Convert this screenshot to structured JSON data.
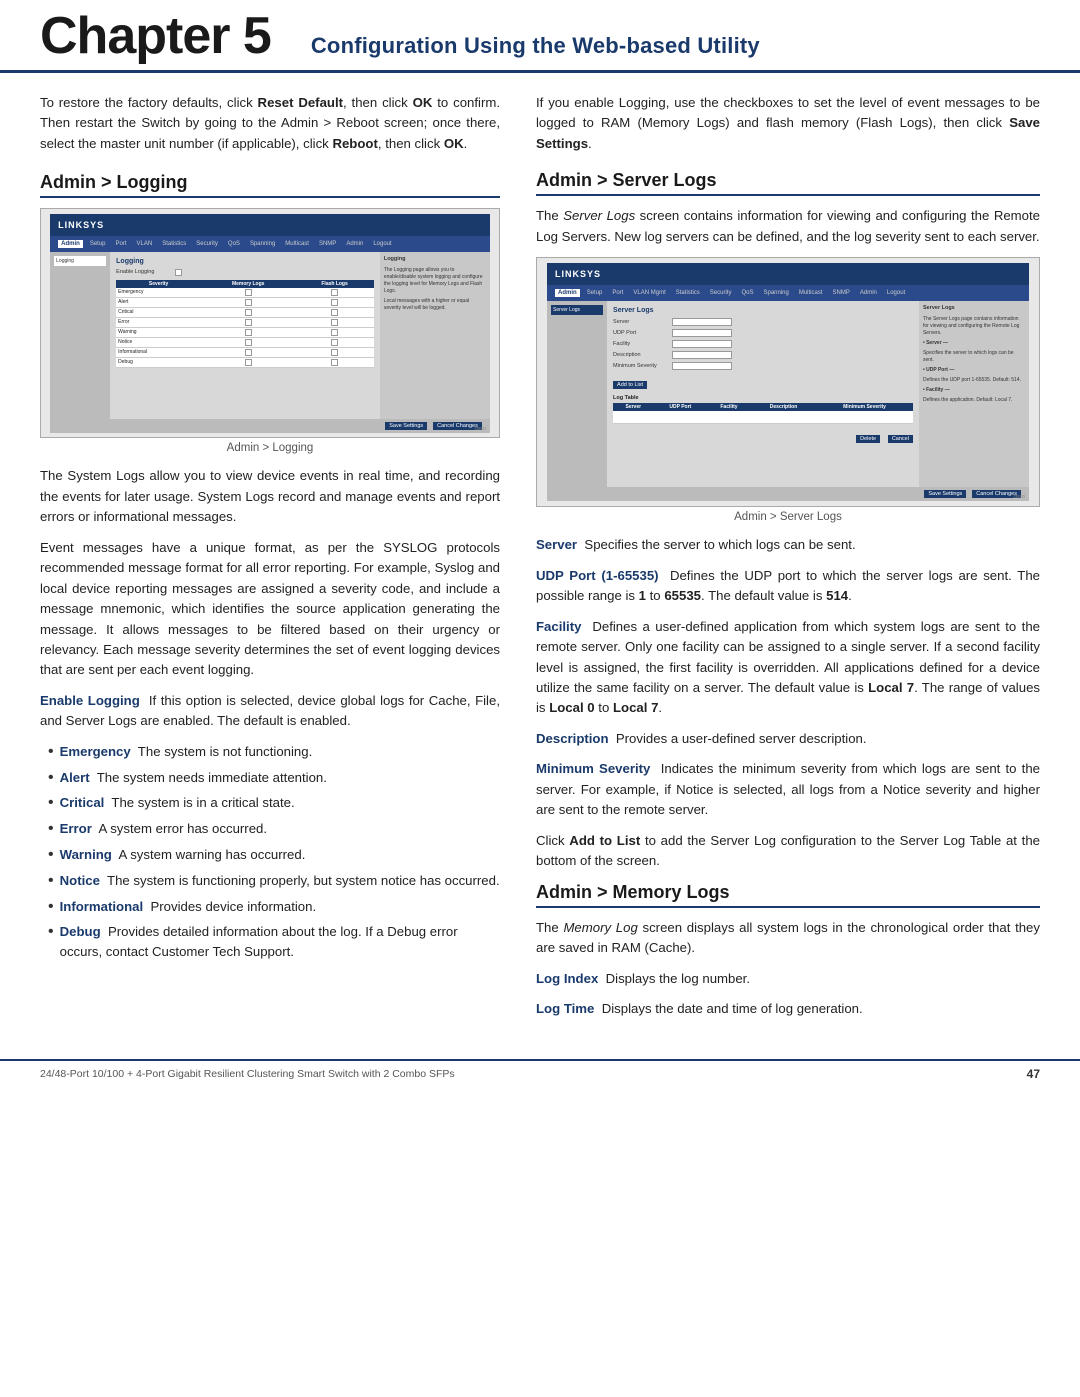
{
  "header": {
    "chapter_label": "Chapter 5",
    "subtitle": "Configuration Using the Web-based Utility"
  },
  "left_col": {
    "intro_paragraph": "To restore the factory defaults, click Reset Default, then click OK to confirm. Then restart the Switch by going to the Admin > Reboot screen; once there, select the master unit number (if applicable), click Reboot, then click OK.",
    "section1_heading": "Admin > Logging",
    "screenshot1_caption": "Admin > Logging",
    "body_paragraph1": "The System Logs allow you to view device events in real time, and recording the events for later usage. System Logs record and manage events and report errors or informational messages.",
    "body_paragraph2": "Event messages have a unique format, as per the SYSLOG protocols recommended message format for all error reporting. For example, Syslog and local device reporting messages are assigned a severity code, and include a message mnemonic, which identifies the source application generating the message. It allows messages to be filtered based on their urgency or relevancy. Each message severity determines the set of event logging devices that are sent per each event logging.",
    "enable_logging_term": "Enable Logging",
    "enable_logging_desc": "If this option is selected, device global logs for Cache, File, and Server Logs are enabled. The default is enabled.",
    "bullets": [
      {
        "term": "Emergency",
        "desc": "The system is not functioning."
      },
      {
        "term": "Alert",
        "desc": "The system needs immediate attention."
      },
      {
        "term": "Critical",
        "desc": "The system is in a critical state."
      },
      {
        "term": "Error",
        "desc": "A system error has occurred."
      },
      {
        "term": "Warning",
        "desc": "A system warning has occurred."
      },
      {
        "term": "Notice",
        "desc": "The system is functioning properly, but system notice has occurred."
      },
      {
        "term": "Informational",
        "desc": "Provides device information."
      },
      {
        "term": "Debug",
        "desc": "Provides detailed information about the log. If a Debug error occurs, contact Customer Tech Support."
      }
    ]
  },
  "right_col": {
    "intro_paragraph": "If you enable Logging, use the checkboxes to set the level of event messages to be logged to RAM (Memory Logs) and flash memory (Flash Logs), then click Save Settings.",
    "section2_heading": "Admin > Server Logs",
    "server_logs_intro": "The Server Logs screen contains information for viewing and configuring the Remote Log Servers. New log servers can be defined, and the log severity sent to each server.",
    "screenshot2_caption": "Admin > Server Logs",
    "definitions": [
      {
        "term": "Server",
        "desc": "Specifies the server to which logs can be sent."
      },
      {
        "term": "UDP Port (1-65535)",
        "desc": "Defines the UDP port to which the server logs are sent. The possible range is 1 to 65535. The default value is 514."
      },
      {
        "term": "Facility",
        "desc": "Defines a user-defined application from which system logs are sent to the remote server. Only one facility can be assigned to a single server. If a second facility level is assigned, the first facility is overridden. All applications defined for a device utilize the same facility on a server. The default value is Local 7. The range of values is Local 0 to Local 7."
      },
      {
        "term": "Description",
        "desc": "Provides a user-defined server description."
      },
      {
        "term": "Minimum Severity",
        "desc": "Indicates the minimum severity from which logs are sent to the server. For example, if Notice is selected, all logs from a Notice severity and higher are sent to the remote server."
      }
    ],
    "add_to_list_text": "Click Add to List to add the Server Log configuration to the Server Log Table at the bottom of the screen.",
    "section3_heading": "Admin > Memory Logs",
    "memory_logs_intro": "The Memory Log screen displays all system logs in the chronological order that they are saved in RAM (Cache).",
    "memory_defs": [
      {
        "term": "Log Index",
        "desc": "Displays the log number."
      },
      {
        "term": "Log Time",
        "desc": "Displays the date and time of log generation."
      }
    ]
  },
  "footer": {
    "left_text": "24/48-Port 10/100 + 4-Port Gigabit Resilient Clustering Smart Switch with 2 Combo SFPs",
    "page_number": "47"
  }
}
